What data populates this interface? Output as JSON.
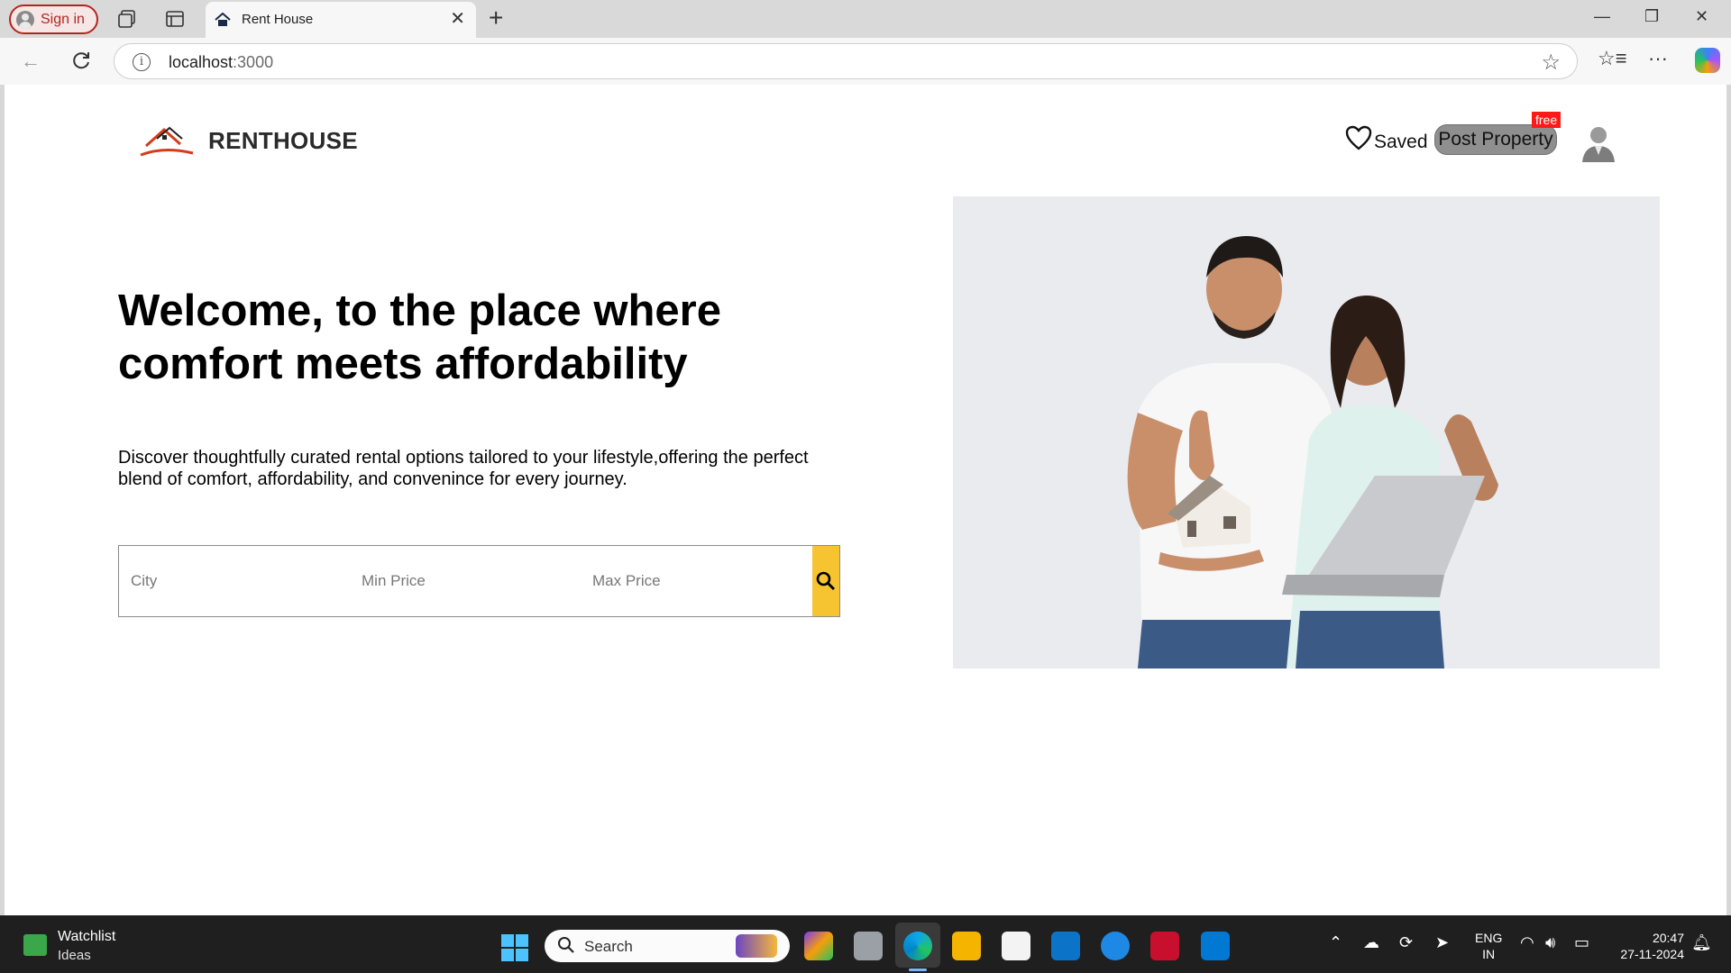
{
  "browser": {
    "signin_label": "Sign in",
    "tab_title": "Rent House",
    "url_host": "localhost",
    "url_port": ":3000"
  },
  "header": {
    "brand": "RENTHOUSE",
    "saved_label": "Saved",
    "post_property_label": "Post Property",
    "free_badge": "free"
  },
  "hero": {
    "title": "Welcome, to the place where comfort meets affordability",
    "description": "Discover thoughtfully curated rental options tailored to your lifestyle,offering the perfect blend of comfort, affordability, and convenince for every journey."
  },
  "search": {
    "city_placeholder": "City",
    "min_price_placeholder": "Min Price",
    "max_price_placeholder": "Max Price"
  },
  "taskbar": {
    "widget_title": "Watchlist",
    "widget_subtitle": "Ideas",
    "search_label": "Search",
    "lang_line1": "ENG",
    "lang_line2": "IN",
    "time": "20:47",
    "date": "27-11-2024"
  },
  "colors": {
    "search_button": "#f7c431",
    "post_button": "#8f8f8f",
    "free_badge": "#ff1a1a",
    "signin_accent": "#b3261e"
  }
}
